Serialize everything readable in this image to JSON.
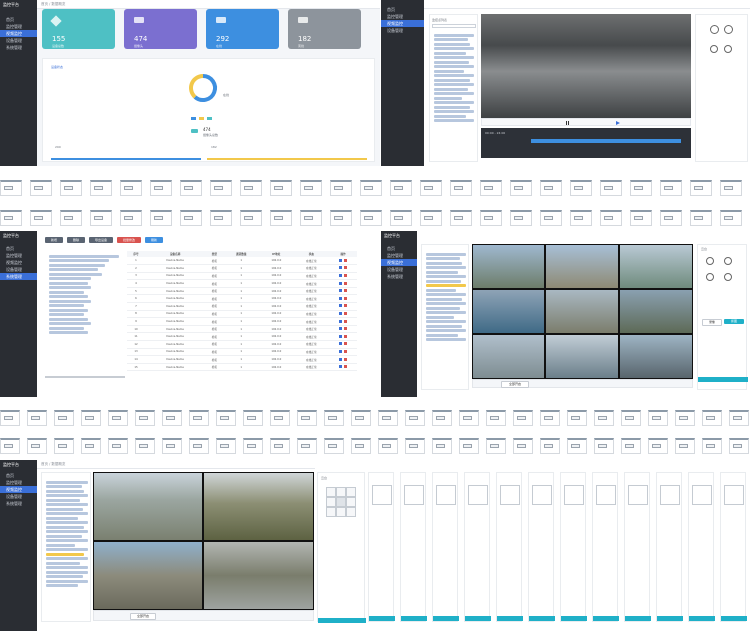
{
  "colors": {
    "sidebar": "#2a2d33",
    "accent": "#3a6fd8",
    "teal": "#4ec0c4",
    "purple": "#7b6fd0",
    "blue": "#3d8fe0",
    "gray": "#8d949c",
    "cyan_bar": "#1fb0c8"
  },
  "app": {
    "brand": "监控平台",
    "breadcrumb": "首页 / 数据概览"
  },
  "sidebar_a": {
    "items": [
      {
        "label": "首页",
        "icon": "home-icon"
      },
      {
        "label": "监控管理",
        "icon": "monitor-icon"
      },
      {
        "label": "视频监控",
        "icon": "camera-icon"
      },
      {
        "label": "设备管理",
        "icon": "device-icon"
      },
      {
        "label": "系统管理",
        "icon": "gear-icon"
      }
    ]
  },
  "stats": [
    {
      "value": "155",
      "label": "设备总数",
      "color": "#4ec0c4",
      "icon": "cube-icon"
    },
    {
      "value": "474",
      "label": "摄像头",
      "color": "#7b6fd0",
      "icon": "camera-icon"
    },
    {
      "value": "292",
      "label": "在线",
      "color": "#3d8fe0",
      "icon": "camera-icon"
    },
    {
      "value": "182",
      "label": "离线",
      "color": "#8d949c",
      "icon": "camera-icon"
    }
  ],
  "chart_section": {
    "tag": "设备状态",
    "center_label": "在线",
    "legend_value": "474",
    "legend_label": "摄像头总数",
    "footer_left": "290",
    "footer_right": "182"
  },
  "chart_data": {
    "type": "pie",
    "title": "",
    "categories": [
      "在线",
      "离线"
    ],
    "values": [
      292,
      182
    ],
    "colors": [
      "#3d8fe0",
      "#f2c84b"
    ]
  },
  "playback": {
    "tree_title": "监控点列表",
    "search_placeholder": "请输入",
    "controls": [
      "rewind",
      "pause",
      "play",
      "forward"
    ],
    "timeline_label": "00:00 - 24:00"
  },
  "table_view": {
    "toolbar_buttons": [
      "新增",
      "删除",
      "导出设备",
      "批量修改",
      "刷新"
    ],
    "columns": [
      "序号",
      "设备名称",
      "类型",
      "通道数量",
      "IP地址",
      "状态",
      "操作"
    ],
    "rows": [
      [
        "1",
        "Device-Name",
        "枪机",
        "1",
        "192.0.0",
        "在线正常"
      ],
      [
        "2",
        "Device-Name",
        "枪机",
        "1",
        "192.0.0",
        "在线正常"
      ],
      [
        "3",
        "Device-Name",
        "枪机",
        "1",
        "192.0.0",
        "在线正常"
      ],
      [
        "4",
        "Device-Name",
        "枪机",
        "1",
        "192.0.0",
        "在线正常"
      ],
      [
        "5",
        "Device-Name",
        "枪机",
        "1",
        "192.0.0",
        "在线正常"
      ],
      [
        "6",
        "Device-Name",
        "枪机",
        "1",
        "192.0.0",
        "在线正常"
      ],
      [
        "7",
        "Device-Name",
        "枪机",
        "1",
        "192.0.0",
        "在线正常"
      ],
      [
        "8",
        "Device-Name",
        "枪机",
        "1",
        "192.0.0",
        "在线正常"
      ],
      [
        "9",
        "Device-Name",
        "枪机",
        "1",
        "192.0.0",
        "在线正常"
      ],
      [
        "10",
        "Device-Name",
        "枪机",
        "1",
        "192.0.0",
        "在线正常"
      ],
      [
        "11",
        "Device-Name",
        "枪机",
        "1",
        "192.0.0",
        "在线正常"
      ],
      [
        "12",
        "Device-Name",
        "枪机",
        "1",
        "192.0.0",
        "在线正常"
      ],
      [
        "13",
        "Device-Name",
        "枪机",
        "1",
        "192.0.0",
        "在线正常"
      ],
      [
        "14",
        "Device-Name",
        "枪机",
        "1",
        "192.0.0",
        "在线正常"
      ],
      [
        "15",
        "Device-Name",
        "枪机",
        "1",
        "192.0.0",
        "在线正常"
      ]
    ]
  },
  "grid_view": {
    "ptz_title": "云台",
    "button_record": "录像",
    "button_capture": "抓图",
    "footer_button": "全部开启"
  },
  "quad_view": {
    "ptz_title": "云台",
    "footer_button": "全部开启"
  }
}
